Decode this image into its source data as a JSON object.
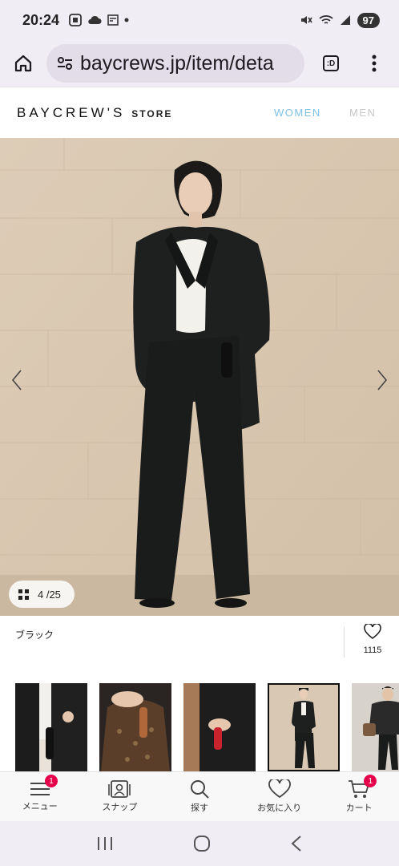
{
  "status": {
    "time": "20:24",
    "battery": "97"
  },
  "browser": {
    "url": "baycrews.jp/item/deta",
    "tab_label": ":D"
  },
  "site": {
    "logo": "BAYCREW'S",
    "logo_suffix": "STORE",
    "nav_women": "WOMEN",
    "nav_men": "MEN"
  },
  "gallery": {
    "counter": "4 /25",
    "current": 4,
    "total": 25
  },
  "product": {
    "color_name": "ブラック",
    "favorite_count": "1115"
  },
  "bottom_nav": {
    "menu": "メニュー",
    "menu_badge": "1",
    "snap": "スナップ",
    "search": "探す",
    "favorites": "お気に入り",
    "cart": "カート",
    "cart_badge": "1"
  },
  "colors": {
    "accent_women": "#7fc1e3",
    "badge": "#e6004c"
  }
}
